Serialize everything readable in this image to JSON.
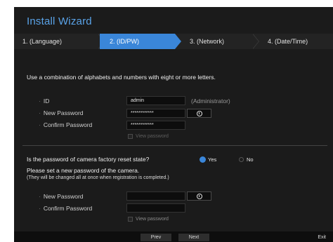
{
  "window": {
    "title": "Install Wizard"
  },
  "steps": [
    {
      "label": "1. (Language)"
    },
    {
      "label": "2. (ID/PW)"
    },
    {
      "label": "3. (Network)"
    },
    {
      "label": "4. (Date/Time)"
    }
  ],
  "active_step": "2. (ID/PW)",
  "instruction": "Use a combination of alphabets and numbers with eight or more letters.",
  "account": {
    "id_label": "ID",
    "id_value": "admin",
    "id_note": "(Administrator)",
    "new_password_label": "New Password",
    "new_password_value": "************",
    "confirm_password_label": "Confirm Password",
    "confirm_password_value": "************",
    "view_password_label": "View password"
  },
  "camera": {
    "question": "Is the password of camera factory reset state?",
    "yes_label": "Yes",
    "no_label": "No",
    "selected": "Yes",
    "message": "Please set a new password of the camera.",
    "note": "(They will be changed all at once when registration is completed.)",
    "new_password_label": "New Password",
    "new_password_value": "",
    "confirm_password_label": "Confirm Password",
    "confirm_password_value": "",
    "view_password_label": "View password"
  },
  "footer": {
    "prev_label": "Prev",
    "next_label": "Next",
    "exit_label": "Exit"
  },
  "colors": {
    "accent": "#3a86d9",
    "title": "#5aa3e8",
    "background": "#1b1b1b"
  }
}
